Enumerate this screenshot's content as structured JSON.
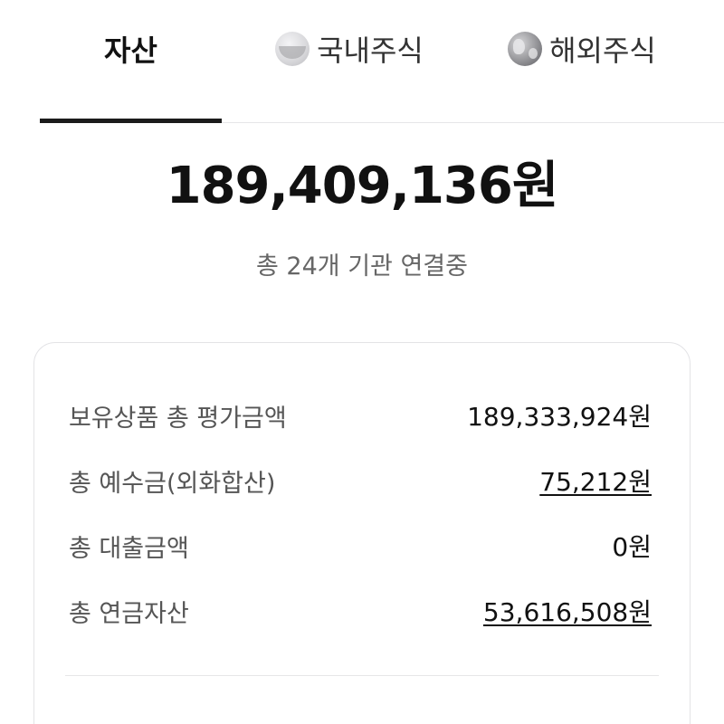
{
  "tabs": [
    {
      "label": "자산",
      "active": true
    },
    {
      "label": "국내주식",
      "icon": "korea-flag-icon"
    },
    {
      "label": "해외주식",
      "icon": "globe-icon"
    }
  ],
  "summary": {
    "total_amount": "189,409,136원",
    "connection_status": "총 24개 기관 연결중"
  },
  "card": {
    "rows": [
      {
        "label": "보유상품 총 평가금액",
        "value": "189,333,924원"
      },
      {
        "label": "총 예수금(외화합산)",
        "value": "75,212원"
      },
      {
        "label": "총 대출금액",
        "value": "0원"
      },
      {
        "label": "총 연금자산",
        "value": "53,616,508원"
      }
    ]
  },
  "colors": {
    "active_indicator": "#1b1b1b",
    "text_primary": "#111111",
    "text_secondary": "#666666",
    "border": "#e3e3e6"
  }
}
